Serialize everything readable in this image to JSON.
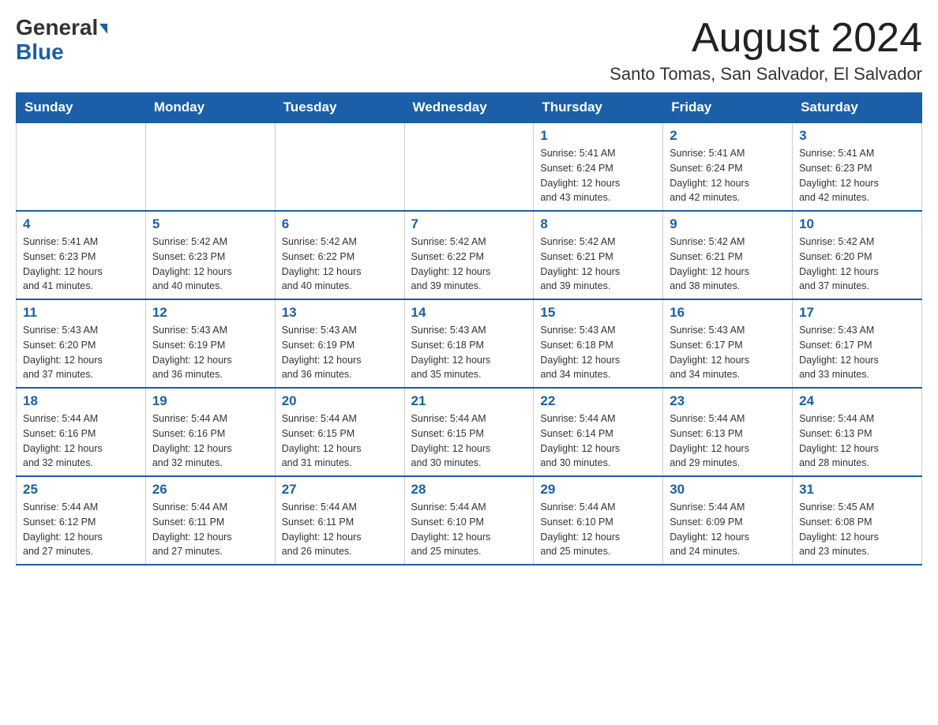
{
  "header": {
    "logo_general": "General",
    "logo_blue": "Blue",
    "month_title": "August 2024",
    "subtitle": "Santo Tomas, San Salvador, El Salvador"
  },
  "days_of_week": [
    "Sunday",
    "Monday",
    "Tuesday",
    "Wednesday",
    "Thursday",
    "Friday",
    "Saturday"
  ],
  "weeks": [
    [
      {
        "day": "",
        "info": ""
      },
      {
        "day": "",
        "info": ""
      },
      {
        "day": "",
        "info": ""
      },
      {
        "day": "",
        "info": ""
      },
      {
        "day": "1",
        "info": "Sunrise: 5:41 AM\nSunset: 6:24 PM\nDaylight: 12 hours\nand 43 minutes."
      },
      {
        "day": "2",
        "info": "Sunrise: 5:41 AM\nSunset: 6:24 PM\nDaylight: 12 hours\nand 42 minutes."
      },
      {
        "day": "3",
        "info": "Sunrise: 5:41 AM\nSunset: 6:23 PM\nDaylight: 12 hours\nand 42 minutes."
      }
    ],
    [
      {
        "day": "4",
        "info": "Sunrise: 5:41 AM\nSunset: 6:23 PM\nDaylight: 12 hours\nand 41 minutes."
      },
      {
        "day": "5",
        "info": "Sunrise: 5:42 AM\nSunset: 6:23 PM\nDaylight: 12 hours\nand 40 minutes."
      },
      {
        "day": "6",
        "info": "Sunrise: 5:42 AM\nSunset: 6:22 PM\nDaylight: 12 hours\nand 40 minutes."
      },
      {
        "day": "7",
        "info": "Sunrise: 5:42 AM\nSunset: 6:22 PM\nDaylight: 12 hours\nand 39 minutes."
      },
      {
        "day": "8",
        "info": "Sunrise: 5:42 AM\nSunset: 6:21 PM\nDaylight: 12 hours\nand 39 minutes."
      },
      {
        "day": "9",
        "info": "Sunrise: 5:42 AM\nSunset: 6:21 PM\nDaylight: 12 hours\nand 38 minutes."
      },
      {
        "day": "10",
        "info": "Sunrise: 5:42 AM\nSunset: 6:20 PM\nDaylight: 12 hours\nand 37 minutes."
      }
    ],
    [
      {
        "day": "11",
        "info": "Sunrise: 5:43 AM\nSunset: 6:20 PM\nDaylight: 12 hours\nand 37 minutes."
      },
      {
        "day": "12",
        "info": "Sunrise: 5:43 AM\nSunset: 6:19 PM\nDaylight: 12 hours\nand 36 minutes."
      },
      {
        "day": "13",
        "info": "Sunrise: 5:43 AM\nSunset: 6:19 PM\nDaylight: 12 hours\nand 36 minutes."
      },
      {
        "day": "14",
        "info": "Sunrise: 5:43 AM\nSunset: 6:18 PM\nDaylight: 12 hours\nand 35 minutes."
      },
      {
        "day": "15",
        "info": "Sunrise: 5:43 AM\nSunset: 6:18 PM\nDaylight: 12 hours\nand 34 minutes."
      },
      {
        "day": "16",
        "info": "Sunrise: 5:43 AM\nSunset: 6:17 PM\nDaylight: 12 hours\nand 34 minutes."
      },
      {
        "day": "17",
        "info": "Sunrise: 5:43 AM\nSunset: 6:17 PM\nDaylight: 12 hours\nand 33 minutes."
      }
    ],
    [
      {
        "day": "18",
        "info": "Sunrise: 5:44 AM\nSunset: 6:16 PM\nDaylight: 12 hours\nand 32 minutes."
      },
      {
        "day": "19",
        "info": "Sunrise: 5:44 AM\nSunset: 6:16 PM\nDaylight: 12 hours\nand 32 minutes."
      },
      {
        "day": "20",
        "info": "Sunrise: 5:44 AM\nSunset: 6:15 PM\nDaylight: 12 hours\nand 31 minutes."
      },
      {
        "day": "21",
        "info": "Sunrise: 5:44 AM\nSunset: 6:15 PM\nDaylight: 12 hours\nand 30 minutes."
      },
      {
        "day": "22",
        "info": "Sunrise: 5:44 AM\nSunset: 6:14 PM\nDaylight: 12 hours\nand 30 minutes."
      },
      {
        "day": "23",
        "info": "Sunrise: 5:44 AM\nSunset: 6:13 PM\nDaylight: 12 hours\nand 29 minutes."
      },
      {
        "day": "24",
        "info": "Sunrise: 5:44 AM\nSunset: 6:13 PM\nDaylight: 12 hours\nand 28 minutes."
      }
    ],
    [
      {
        "day": "25",
        "info": "Sunrise: 5:44 AM\nSunset: 6:12 PM\nDaylight: 12 hours\nand 27 minutes."
      },
      {
        "day": "26",
        "info": "Sunrise: 5:44 AM\nSunset: 6:11 PM\nDaylight: 12 hours\nand 27 minutes."
      },
      {
        "day": "27",
        "info": "Sunrise: 5:44 AM\nSunset: 6:11 PM\nDaylight: 12 hours\nand 26 minutes."
      },
      {
        "day": "28",
        "info": "Sunrise: 5:44 AM\nSunset: 6:10 PM\nDaylight: 12 hours\nand 25 minutes."
      },
      {
        "day": "29",
        "info": "Sunrise: 5:44 AM\nSunset: 6:10 PM\nDaylight: 12 hours\nand 25 minutes."
      },
      {
        "day": "30",
        "info": "Sunrise: 5:44 AM\nSunset: 6:09 PM\nDaylight: 12 hours\nand 24 minutes."
      },
      {
        "day": "31",
        "info": "Sunrise: 5:45 AM\nSunset: 6:08 PM\nDaylight: 12 hours\nand 23 minutes."
      }
    ]
  ]
}
